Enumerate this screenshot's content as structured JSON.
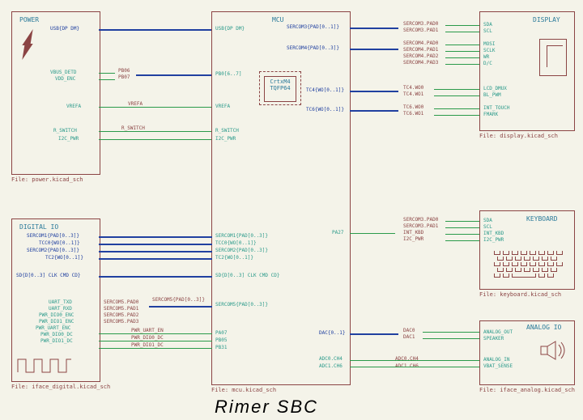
{
  "title": "Rimer SBC",
  "blocks": {
    "power": {
      "title": "POWER",
      "file": "File: power.kicad_sch",
      "ports_right": [
        "USB{DP DM}",
        "VBUS_DETD",
        "VDD_ENC",
        "VREFA",
        "R_SWITCH",
        "I2C_PWR"
      ],
      "nets_out": [
        "PB06",
        "PB07",
        "VREFA",
        "R_SWITCH"
      ]
    },
    "digital_io": {
      "title": "DIGITAL IO",
      "file": "File: iface_digital.kicad_sch",
      "ports_right_bus": [
        "SERCOM1{PAD[0..3]}",
        "TCC0{WO[0..1]}",
        "SERCOM2{PAD[0..3]}",
        "TC2{WO[0..1]}"
      ],
      "sd": "SD{D[0..3] CLK CMD CD}",
      "uart": [
        "UART_TXD",
        "UART_RXD",
        "PWR_DIO0_ENC",
        "PWR_DIO1_ENC",
        "PWR_UART_ENC",
        "PWR_DIO0_DC",
        "PWR_DIO1_DC"
      ],
      "sercom5": [
        "SERCOM5.PAD0",
        "SERCOM5.PAD1",
        "SERCOM5.PAD2",
        "SERCOM5.PAD3"
      ],
      "mcu_side": [
        "SERCOM5{PAD[0..3]}",
        "PWR_UART_EN",
        "PWR_DIO0_DC",
        "PWR_DIO1_DC"
      ]
    },
    "mcu": {
      "title": "MCU",
      "file": "File: mcu.kicad_sch",
      "chip1": "CrtxM4",
      "chip2": "TQFP64",
      "ports_left": [
        "USB{DP DM}",
        "PB0[6..7]",
        "VREFA",
        "R_SWITCH",
        "I2C_PWR",
        "SERCOM1{PAD[0..3]}",
        "TCC0{WO[0..1]}",
        "SERCOM2{PAD[0..3]}",
        "TC2{WO[0..1]}",
        "SD{D[0..3] CLK CMD CD}",
        "SERCOM5{PAD[0..3]}",
        "PA07",
        "PB05",
        "PB31"
      ],
      "ports_right_bus": [
        "SERCOM3{PAD[0..1]}",
        "SERCOM4{PAD[0..3]}",
        "TC4{WO[0..1]}",
        "TC6{WO[0..1]}",
        "PA27",
        "DAC{0..1}"
      ],
      "adc": [
        "ADC0.CH4",
        "ADC1.CH6"
      ],
      "sercom3": [
        "SERCOM3.PAD0",
        "SERCOM3.PAD1"
      ],
      "sercom4": [
        "SERCOM4.PAD0",
        "SERCOM4.PAD1",
        "SERCOM4.PAD2",
        "SERCOM4.PAD3"
      ],
      "tc4": [
        "TC4.WO0",
        "TC4.WO1"
      ],
      "tc6": [
        "TC6.WO0",
        "TC6.WO1"
      ],
      "dac": [
        "DAC0",
        "DAC1"
      ],
      "kbd_nets": [
        "SERCOM3.PAD0",
        "SERCOM3.PAD1",
        "INT_KBD",
        "I2C_PWR"
      ]
    },
    "display": {
      "title": "DISPLAY",
      "file": "File: display.kicad_sch",
      "ports": [
        "SDA",
        "SCL",
        "MOSI",
        "SCLK",
        "WR",
        "D/C",
        "LCD_DMUX",
        "BL_PWM",
        "INT_TOUCH",
        "FMARK"
      ]
    },
    "keyboard": {
      "title": "KEYBOARD",
      "file": "File: keyboard.kicad_sch",
      "ports": [
        "SDA",
        "SCL",
        "INT_KBD",
        "I2C_PWR"
      ]
    },
    "analog_io": {
      "title": "ANALOG IO",
      "file": "File: iface_analog.kicad_sch",
      "ports": [
        "ANALOG_OUT",
        "SPEAKER",
        "ANALOG_IN",
        "VBAT_SENSE"
      ]
    }
  }
}
